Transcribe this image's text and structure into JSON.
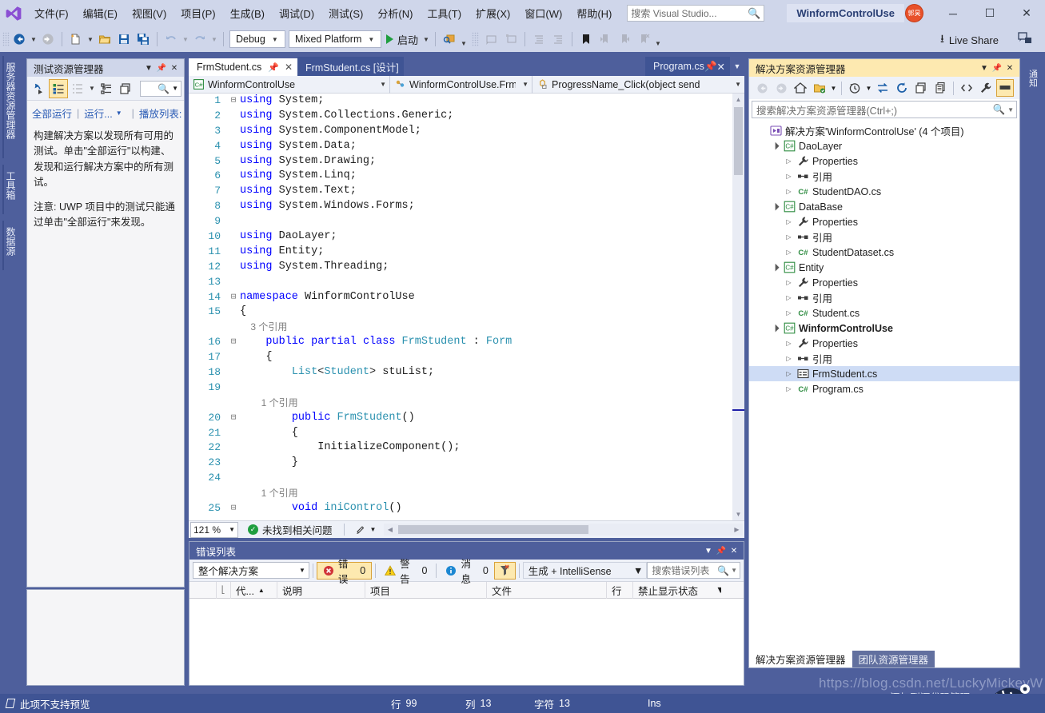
{
  "menubar": {
    "logo_icon": "visual-studio-logo",
    "items": [
      {
        "label": "文件(F)"
      },
      {
        "label": "编辑(E)"
      },
      {
        "label": "视图(V)"
      },
      {
        "label": "项目(P)"
      },
      {
        "label": "生成(B)"
      },
      {
        "label": "调试(D)"
      },
      {
        "label": "测试(S)"
      },
      {
        "label": "分析(N)"
      },
      {
        "label": "工具(T)"
      },
      {
        "label": "扩展(X)"
      },
      {
        "label": "窗口(W)"
      },
      {
        "label": "帮助(H)"
      }
    ],
    "search_placeholder": "搜索 Visual Studio...",
    "search_icon": "search-icon",
    "solution_name": "WinformControlUse",
    "account_label": "郭昊",
    "window_minimize": "─",
    "window_maximize": "☐",
    "window_close": "✕"
  },
  "toolbar": {
    "navigate_back_icon": "navigate-back-icon",
    "navigate_forward_icon": "navigate-forward-icon",
    "new_project_icon": "new-project-icon",
    "open_file_icon": "open-file-icon",
    "save_icon": "save-icon",
    "save_all_icon": "save-all-icon",
    "undo_icon": "undo-icon",
    "redo_icon": "redo-icon",
    "config_value": "Debug",
    "platform_value": "Mixed Platform",
    "start_label": "启动",
    "start_icon": "start-play-icon",
    "find_icon": "find-in-files-icon",
    "comment_icon": "comment-icon",
    "uncomment_icon": "uncomment-icon",
    "outdent_icon": "outdent-icon",
    "indent_icon": "indent-icon",
    "bookmark_icon": "bookmark-icon",
    "prev_bookmark_icon": "prev-bookmark-icon",
    "next_bookmark_icon": "next-bookmark-icon",
    "clear_bookmark_icon": "clear-bookmarks-icon",
    "live_share_label": "Live Share",
    "live_share_icon": "live-share-icon",
    "feedback_icon": "feedback-icon"
  },
  "left_vertical_tabs": [
    {
      "label": "服务器资源管理器"
    },
    {
      "label": "工具箱"
    },
    {
      "label": "数据源"
    }
  ],
  "test_explorer": {
    "title": "测试资源管理器",
    "dropdown_icon": "chevron-down-icon",
    "pin_icon": "pin-icon",
    "close_icon": "close-icon",
    "toolbar": {
      "run_icon": "run-tests-icon",
      "list_view_icon": "list-view-icon",
      "group_icon": "group-by-icon",
      "hierarchy_icon": "hierarchy-icon",
      "columns_icon": "columns-icon",
      "search_icon": "search-icon"
    },
    "links": {
      "run_all": "全部运行",
      "run": "运行...",
      "playlist": "播放列表:"
    },
    "body_p1": "构建解决方案以发现所有可用的测试。单击\"全部运行\"以构建、发现和运行解决方案中的所有测试。",
    "body_p2": "注意: UWP 项目中的测试只能通过单击\"全部运行\"来发现。"
  },
  "editor": {
    "tabs": [
      {
        "label": "FrmStudent.cs",
        "active": true,
        "pin": true,
        "close": true
      },
      {
        "label": "FrmStudent.cs [设计]",
        "active": false,
        "close": false
      }
    ],
    "right_tab": {
      "label": "Program.cs",
      "pin_icon": "pin-icon",
      "close_icon": "close-icon"
    },
    "overflow_icon": "chevron-down-icon",
    "navbar": {
      "project_icon": "csharp-project-icon",
      "project": "WinformControlUse",
      "type_icon": "class-icon",
      "type": "WinformControlUse.FrmStudent",
      "member_icon": "event-method-icon",
      "member": "ProgressName_Click(object send"
    },
    "code_lines": [
      {
        "n": "1",
        "fold": "-",
        "segs": [
          {
            "t": "using ",
            "c": "kw"
          },
          {
            "t": "System;",
            "c": "id"
          }
        ]
      },
      {
        "n": "2",
        "fold": "",
        "segs": [
          {
            "t": "using ",
            "c": "kw"
          },
          {
            "t": "System.Collections.Generic;",
            "c": "id"
          }
        ]
      },
      {
        "n": "3",
        "fold": "",
        "segs": [
          {
            "t": "using ",
            "c": "kw"
          },
          {
            "t": "System.ComponentModel;",
            "c": "id"
          }
        ]
      },
      {
        "n": "4",
        "fold": "",
        "segs": [
          {
            "t": "using ",
            "c": "kw"
          },
          {
            "t": "System.Data;",
            "c": "id"
          }
        ]
      },
      {
        "n": "5",
        "fold": "",
        "segs": [
          {
            "t": "using ",
            "c": "kw"
          },
          {
            "t": "System.Drawing;",
            "c": "id"
          }
        ]
      },
      {
        "n": "6",
        "fold": "",
        "segs": [
          {
            "t": "using ",
            "c": "kw"
          },
          {
            "t": "System.Linq;",
            "c": "id"
          }
        ]
      },
      {
        "n": "7",
        "fold": "",
        "segs": [
          {
            "t": "using ",
            "c": "kw"
          },
          {
            "t": "System.Text;",
            "c": "id"
          }
        ]
      },
      {
        "n": "8",
        "fold": "",
        "segs": [
          {
            "t": "using ",
            "c": "kw"
          },
          {
            "t": "System.Windows.Forms;",
            "c": "id"
          }
        ]
      },
      {
        "n": "9",
        "fold": "",
        "segs": []
      },
      {
        "n": "10",
        "fold": "",
        "segs": [
          {
            "t": "using ",
            "c": "kw"
          },
          {
            "t": "DaoLayer;",
            "c": "id"
          }
        ]
      },
      {
        "n": "11",
        "fold": "",
        "segs": [
          {
            "t": "using ",
            "c": "kw"
          },
          {
            "t": "Entity;",
            "c": "id"
          }
        ]
      },
      {
        "n": "12",
        "fold": "",
        "segs": [
          {
            "t": "using ",
            "c": "kw"
          },
          {
            "t": "System.Threading;",
            "c": "id"
          }
        ]
      },
      {
        "n": "13",
        "fold": "",
        "segs": []
      },
      {
        "n": "14",
        "fold": "-",
        "segs": [
          {
            "t": "namespace ",
            "c": "kw"
          },
          {
            "t": "WinformControlUse",
            "c": "id"
          }
        ]
      },
      {
        "n": "15",
        "fold": "",
        "segs": [
          {
            "t": "{",
            "c": "id"
          }
        ]
      },
      {
        "n": "",
        "fold": "",
        "segs": [
          {
            "t": "    3 个引用",
            "c": "cref"
          }
        ]
      },
      {
        "n": "16",
        "fold": "-",
        "segs": [
          {
            "t": "    ",
            "c": "id"
          },
          {
            "t": "public ",
            "c": "kw"
          },
          {
            "t": "partial ",
            "c": "kw"
          },
          {
            "t": "class ",
            "c": "kw"
          },
          {
            "t": "FrmStudent",
            "c": "ty"
          },
          {
            "t": " : ",
            "c": "id"
          },
          {
            "t": "Form",
            "c": "ty"
          }
        ]
      },
      {
        "n": "17",
        "fold": "",
        "segs": [
          {
            "t": "    {",
            "c": "id"
          }
        ]
      },
      {
        "n": "18",
        "fold": "",
        "segs": [
          {
            "t": "        ",
            "c": "id"
          },
          {
            "t": "List",
            "c": "ty"
          },
          {
            "t": "<",
            "c": "id"
          },
          {
            "t": "Student",
            "c": "ty"
          },
          {
            "t": "> stuList;",
            "c": "id"
          }
        ]
      },
      {
        "n": "19",
        "fold": "",
        "segs": []
      },
      {
        "n": "",
        "fold": "",
        "segs": [
          {
            "t": "        1 个引用",
            "c": "cref"
          }
        ]
      },
      {
        "n": "20",
        "fold": "-",
        "segs": [
          {
            "t": "        ",
            "c": "id"
          },
          {
            "t": "public ",
            "c": "kw"
          },
          {
            "t": "FrmStudent",
            "c": "ty"
          },
          {
            "t": "()",
            "c": "id"
          }
        ]
      },
      {
        "n": "21",
        "fold": "",
        "segs": [
          {
            "t": "        {",
            "c": "id"
          }
        ]
      },
      {
        "n": "22",
        "fold": "",
        "segs": [
          {
            "t": "            InitializeComponent();",
            "c": "id"
          }
        ]
      },
      {
        "n": "23",
        "fold": "",
        "segs": [
          {
            "t": "        }",
            "c": "id"
          }
        ]
      },
      {
        "n": "24",
        "fold": "",
        "segs": []
      },
      {
        "n": "",
        "fold": "",
        "segs": [
          {
            "t": "        1 个引用",
            "c": "cref"
          }
        ]
      },
      {
        "n": "25",
        "fold": "-",
        "segs": [
          {
            "t": "        ",
            "c": "id"
          },
          {
            "t": "void ",
            "c": "kw"
          },
          {
            "t": "iniControl",
            "c": "ty"
          },
          {
            "t": "()",
            "c": "id"
          }
        ]
      }
    ],
    "status": {
      "zoom": "121 %",
      "issues_text": "未找到相关问题",
      "issues_icon": "check-circle-icon",
      "pen_icon": "pen-icon",
      "splitter_icon": "split-view-icon"
    }
  },
  "error_list": {
    "title": "错误列表",
    "dropdown_icon": "chevron-down-icon",
    "pin_icon": "pin-icon",
    "close_icon": "close-icon",
    "scope_value": "整个解决方案",
    "errors": {
      "label": "错误",
      "count": "0",
      "icon": "error-icon"
    },
    "warnings": {
      "label": "警告",
      "count": "0",
      "icon": "warning-icon"
    },
    "messages": {
      "label": "消息",
      "count": "0",
      "icon": "info-icon"
    },
    "filter_icon": "build-filter-icon",
    "source_value": "生成 + IntelliSense",
    "search_placeholder": "搜索错误列表",
    "search_icon": "search-icon",
    "columns": [
      "",
      "代...",
      "说明",
      "项目",
      "文件",
      "行",
      "禁止显示状态"
    ],
    "sort_icon": "sort-ascending-icon",
    "column_filter_icon": "filter-icon",
    "rows": []
  },
  "solution_explorer": {
    "title": "解决方案资源管理器",
    "dropdown_icon": "chevron-down-icon",
    "pin_icon": "pin-icon",
    "close_icon": "close-icon",
    "toolbar": {
      "back_icon": "back-icon",
      "forward_icon": "forward-icon",
      "home_icon": "home-icon",
      "pending_changes_icon": "pending-changes-icon",
      "history_icon": "history-icon",
      "sync_icon": "sync-with-active-document-icon",
      "refresh_icon": "refresh-icon",
      "collapse_all_icon": "collapse-all-icon",
      "show_all_files_icon": "show-all-files-icon",
      "view_code_icon": "view-code-icon",
      "properties_icon": "properties-wrench-icon",
      "preview_icon": "preview-selected-items-icon"
    },
    "search_placeholder": "搜索解决方案资源管理器(Ctrl+;)",
    "search_icon": "search-icon",
    "tree": [
      {
        "depth": 0,
        "arrow": "",
        "icon": "solution-icon",
        "label": "解决方案'WinformControlUse' (4 个项目)",
        "bold": false,
        "selected": false
      },
      {
        "depth": 1,
        "arrow": "▼",
        "icon": "csproj-icon",
        "label": "DaoLayer",
        "bold": false,
        "selected": false
      },
      {
        "depth": 2,
        "arrow": "▷",
        "icon": "wrench-icon",
        "label": "Properties",
        "bold": false,
        "selected": false
      },
      {
        "depth": 2,
        "arrow": "▷",
        "icon": "references-icon",
        "label": "引用",
        "bold": false,
        "selected": false
      },
      {
        "depth": 2,
        "arrow": "▷",
        "icon": "cs-file-icon",
        "label": "StudentDAO.cs",
        "bold": false,
        "selected": false
      },
      {
        "depth": 1,
        "arrow": "▼",
        "icon": "csproj-icon",
        "label": "DataBase",
        "bold": false,
        "selected": false
      },
      {
        "depth": 2,
        "arrow": "▷",
        "icon": "wrench-icon",
        "label": "Properties",
        "bold": false,
        "selected": false
      },
      {
        "depth": 2,
        "arrow": "▷",
        "icon": "references-icon",
        "label": "引用",
        "bold": false,
        "selected": false
      },
      {
        "depth": 2,
        "arrow": "▷",
        "icon": "cs-file-icon",
        "label": "StudentDataset.cs",
        "bold": false,
        "selected": false
      },
      {
        "depth": 1,
        "arrow": "▼",
        "icon": "csproj-icon",
        "label": "Entity",
        "bold": false,
        "selected": false
      },
      {
        "depth": 2,
        "arrow": "▷",
        "icon": "wrench-icon",
        "label": "Properties",
        "bold": false,
        "selected": false
      },
      {
        "depth": 2,
        "arrow": "▷",
        "icon": "references-icon",
        "label": "引用",
        "bold": false,
        "selected": false
      },
      {
        "depth": 2,
        "arrow": "▷",
        "icon": "cs-file-icon",
        "label": "Student.cs",
        "bold": false,
        "selected": false
      },
      {
        "depth": 1,
        "arrow": "▼",
        "icon": "csproj-icon",
        "label": "WinformControlUse",
        "bold": true,
        "selected": false
      },
      {
        "depth": 2,
        "arrow": "▷",
        "icon": "wrench-icon",
        "label": "Properties",
        "bold": false,
        "selected": false
      },
      {
        "depth": 2,
        "arrow": "▷",
        "icon": "references-icon",
        "label": "引用",
        "bold": false,
        "selected": false
      },
      {
        "depth": 2,
        "arrow": "▷",
        "icon": "form-icon",
        "label": "FrmStudent.cs",
        "bold": false,
        "selected": true
      },
      {
        "depth": 2,
        "arrow": "▷",
        "icon": "cs-file-icon",
        "label": "Program.cs",
        "bold": false,
        "selected": false
      }
    ],
    "bottom_tabs": [
      {
        "label": "解决方案资源管理器",
        "active": true
      },
      {
        "label": "团队资源管理器",
        "active": false
      }
    ],
    "notifications_tab": "通知"
  },
  "statusbar": {
    "message": "此项不支持预览",
    "message_icon": "preview-icon",
    "line_label": "行",
    "line_value": "99",
    "col_label": "列",
    "col_value": "13",
    "char_label": "字符",
    "char_value": "13",
    "insert_mode": "Ins"
  },
  "overlay": {
    "watermark": "https://blog.csdn.net/LuckyMickeyW",
    "source_control": "添加到源代码管理",
    "source_control_icon": "upload-arrow-icon"
  }
}
